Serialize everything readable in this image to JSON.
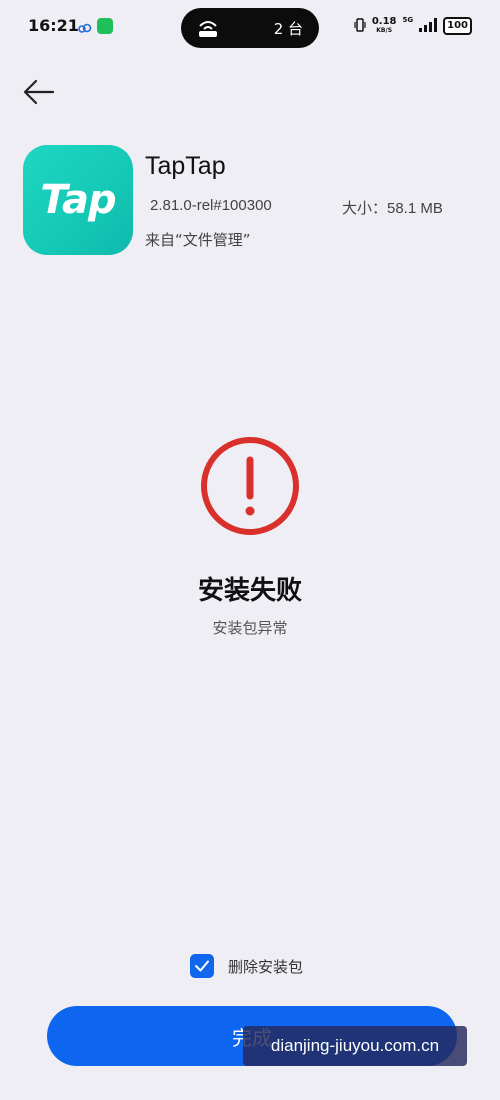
{
  "status_bar": {
    "time": "16:21",
    "island_count": "2 台",
    "net_speed_value": "0.18",
    "net_speed_unit": "KB/S",
    "network_type": "5G",
    "battery": "100"
  },
  "app": {
    "name": "TapTap",
    "icon_text": "Tap",
    "version": "2.81.0-rel#100300",
    "size": "大小：58.1 MB",
    "source": "来自“文件管理”"
  },
  "result": {
    "title": "安装失败",
    "reason": "安装包异常"
  },
  "options": {
    "delete_package_label": "删除安装包",
    "delete_package_checked": true
  },
  "actions": {
    "done_label": "完成"
  },
  "watermark": "dianjing-jiuyou.com.cn",
  "colors": {
    "accent": "#0e66f0",
    "error": "#d9302c",
    "app_icon": "#18cfbc"
  }
}
